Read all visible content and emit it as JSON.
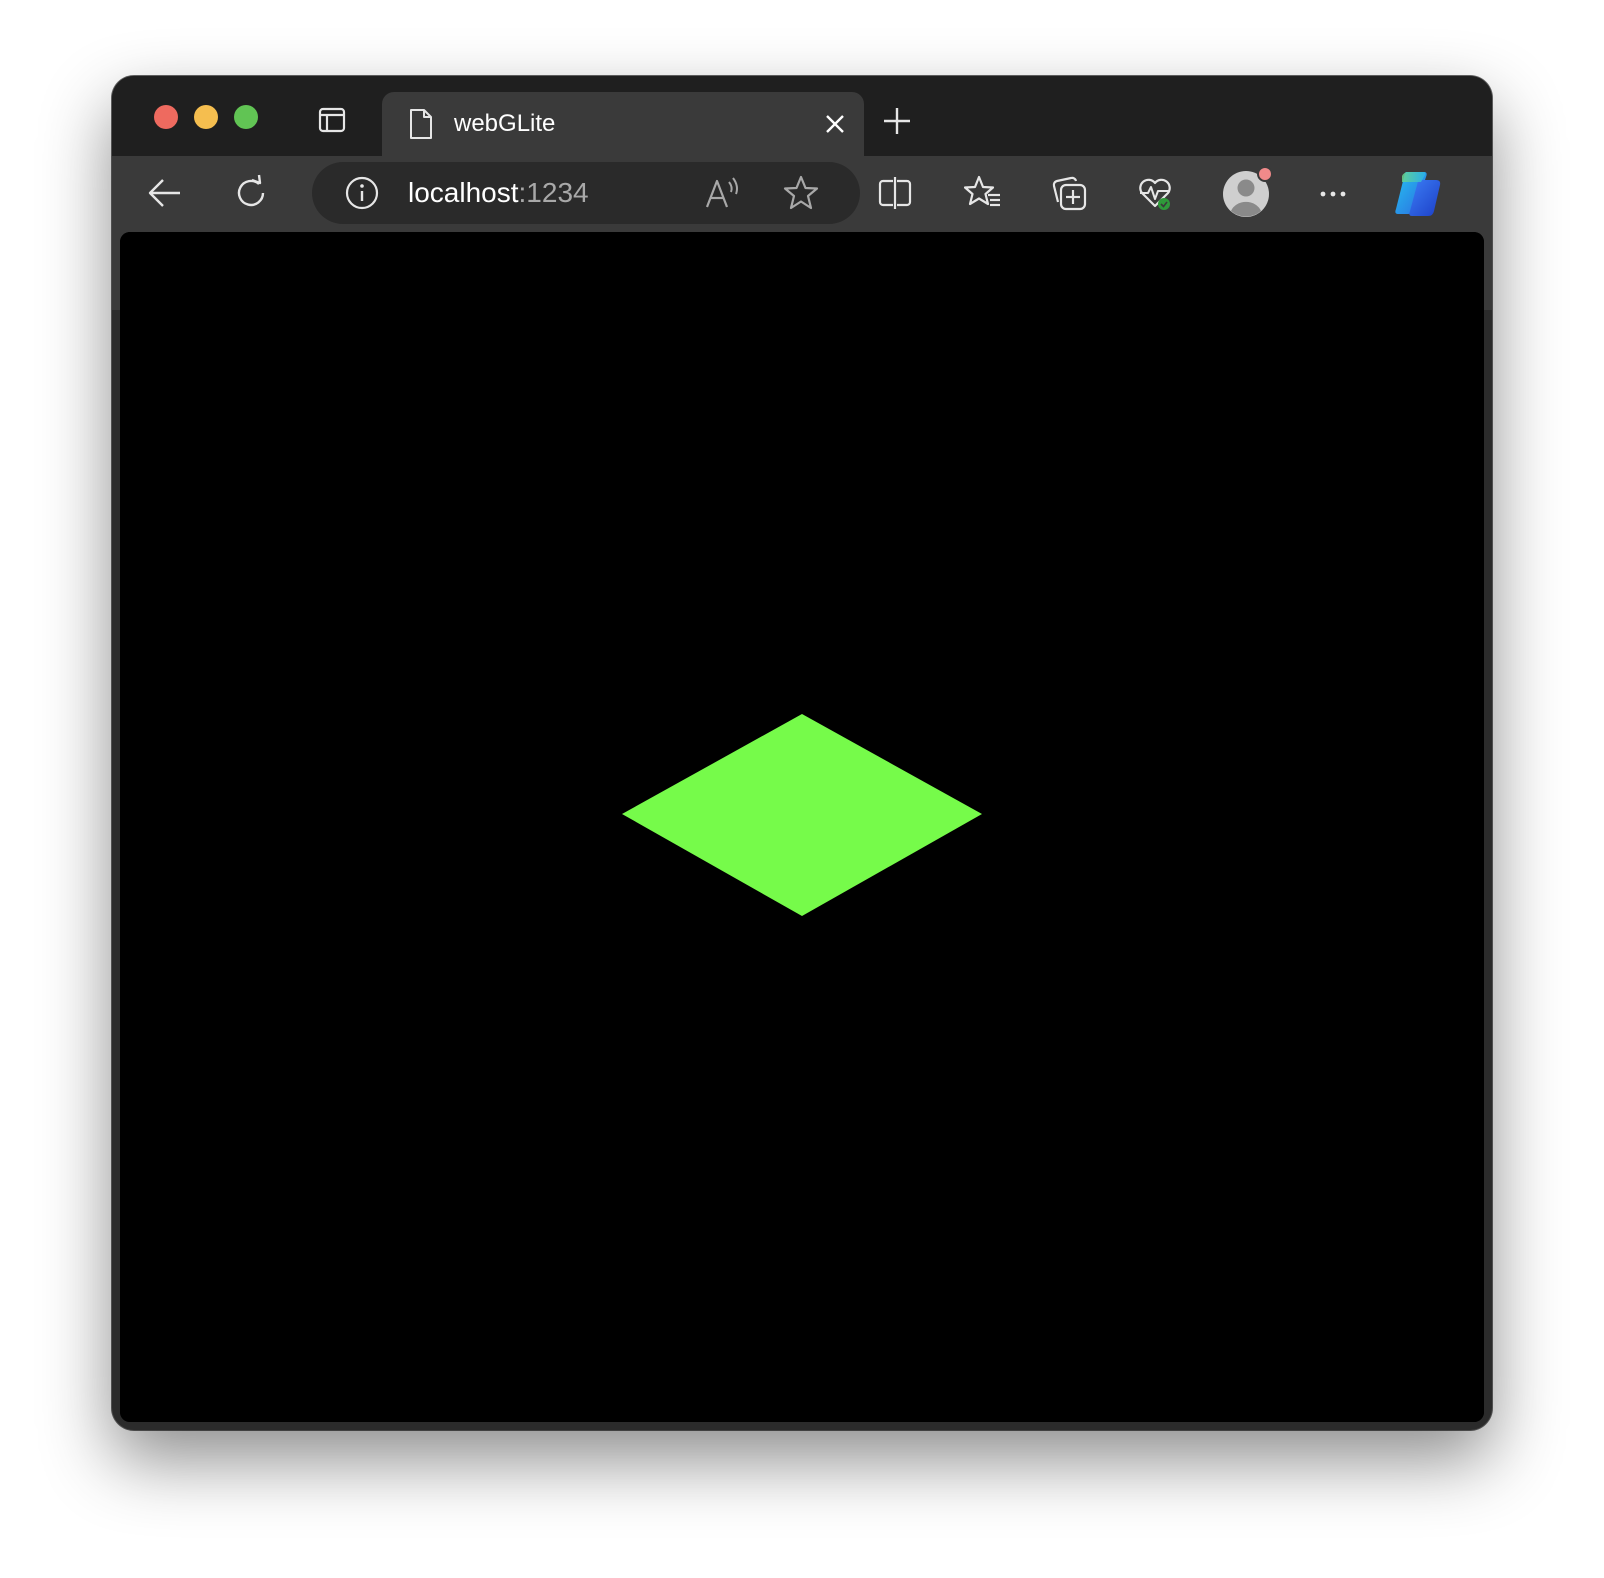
{
  "window": {
    "tab": {
      "title": "webGLite",
      "icon": "document-icon"
    },
    "address_bar": {
      "host": "localhost",
      "port": ":1234"
    },
    "toolbar_icons": [
      "back-arrow-icon",
      "refresh-icon",
      "site-info-icon",
      "read-aloud-icon",
      "favorite-star-icon",
      "split-screen-icon",
      "favorites-list-icon",
      "collections-icon",
      "browser-essentials-icon",
      "profile-avatar",
      "more-options-icon",
      "copilot-icon"
    ]
  },
  "canvas": {
    "background": "#000000",
    "shape": "rhombus",
    "shape_color": "#76fb4a"
  }
}
